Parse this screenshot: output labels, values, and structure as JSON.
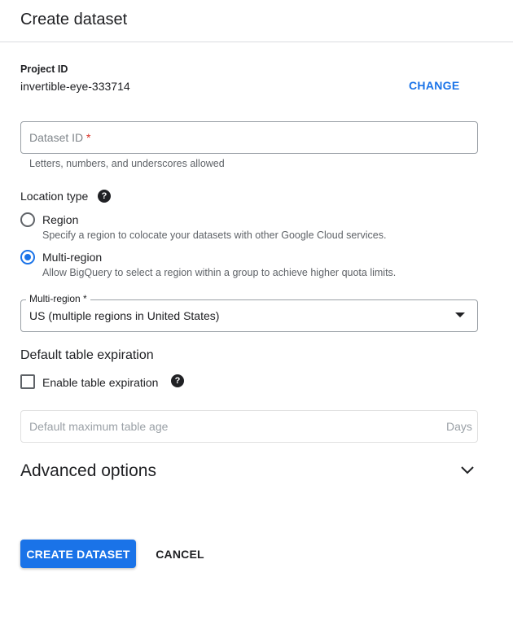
{
  "dialog": {
    "title": "Create dataset"
  },
  "project": {
    "label": "Project ID",
    "value": "invertible-eye-333714",
    "change_label": "CHANGE"
  },
  "dataset_id": {
    "placeholder": "Dataset ID",
    "required_mark": "*",
    "hint": "Letters, numbers, and underscores allowed"
  },
  "location": {
    "label": "Location type",
    "options": [
      {
        "label": "Region",
        "description": "Specify a region to colocate your datasets with other Google Cloud services.",
        "selected": false
      },
      {
        "label": "Multi-region",
        "description": "Allow BigQuery to select a region within a group to achieve higher quota limits.",
        "selected": true
      }
    ],
    "multi_region": {
      "label": "Multi-region *",
      "value": "US (multiple regions in United States)"
    }
  },
  "expiration": {
    "title": "Default table expiration",
    "checkbox_label": "Enable table expiration",
    "checked": false,
    "age_placeholder": "Default maximum table age",
    "age_unit": "Days"
  },
  "advanced": {
    "title": "Advanced options"
  },
  "actions": {
    "create_label": "CREATE DATASET",
    "cancel_label": "CANCEL"
  },
  "colors": {
    "accent": "#1a73e8",
    "required": "#d93025",
    "border": "#9aa0a6"
  }
}
